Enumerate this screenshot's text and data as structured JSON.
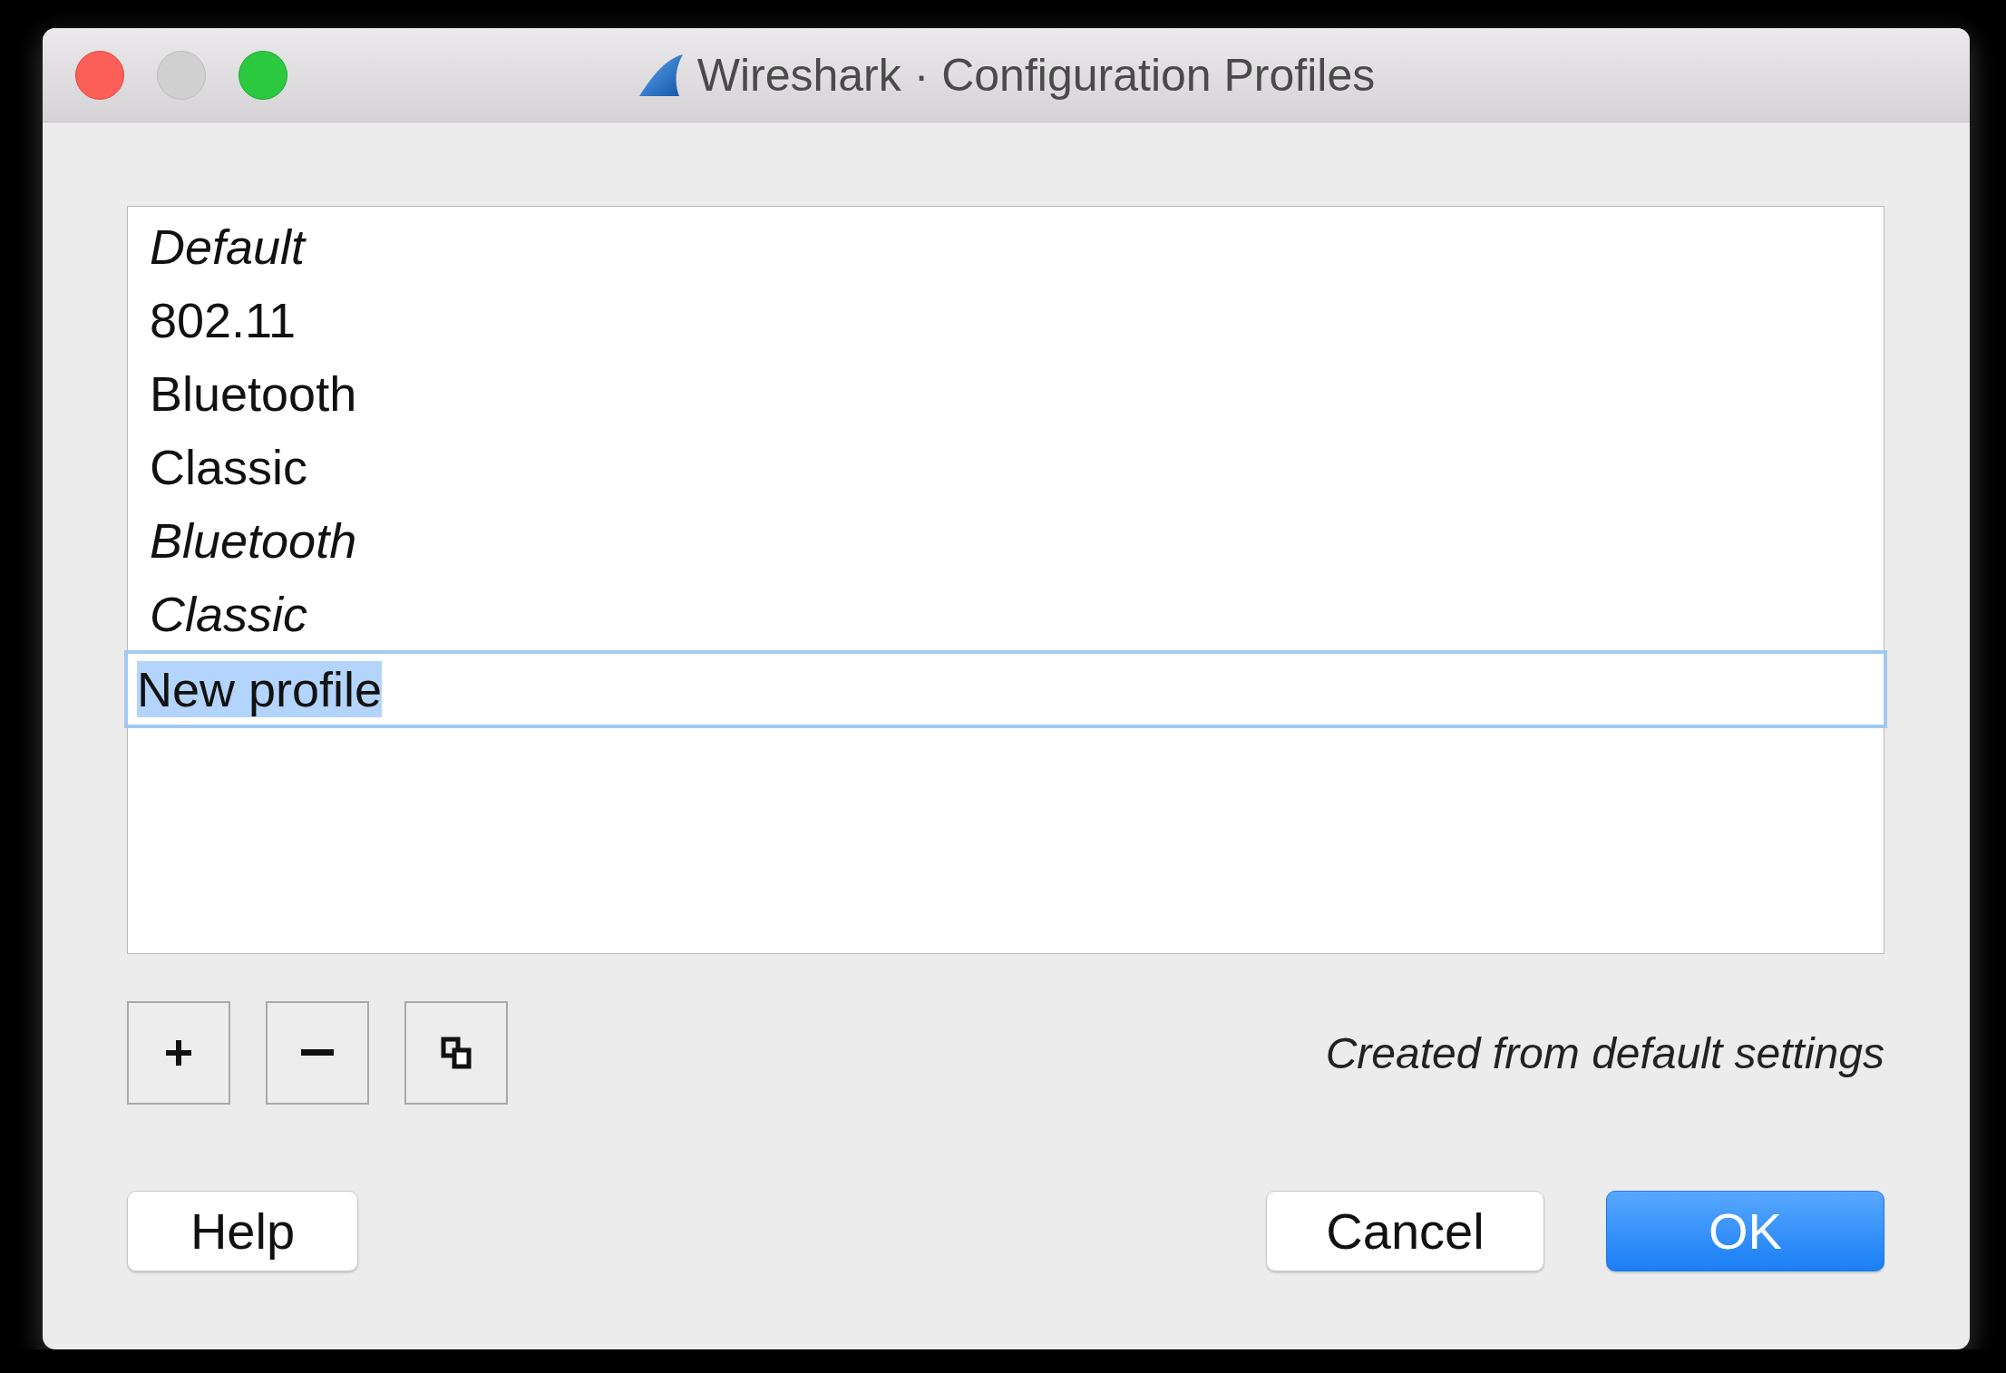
{
  "window": {
    "title": "Wireshark · Configuration Profiles"
  },
  "profiles": [
    {
      "name": "Default",
      "kind": "global"
    },
    {
      "name": "802.11",
      "kind": "personal"
    },
    {
      "name": "Bluetooth",
      "kind": "personal"
    },
    {
      "name": "Classic",
      "kind": "personal"
    },
    {
      "name": "Bluetooth",
      "kind": "global"
    },
    {
      "name": "Classic",
      "kind": "global"
    },
    {
      "name": "New profile",
      "kind": "editing"
    }
  ],
  "tool_buttons": [
    {
      "kind": "add"
    },
    {
      "kind": "remove"
    },
    {
      "kind": "copy"
    }
  ],
  "info": "Created from default settings",
  "buttons": [
    {
      "label": "Help",
      "kind": "plain"
    },
    {
      "label": "Cancel",
      "kind": "plain"
    },
    {
      "label": "OK",
      "kind": "default"
    }
  ]
}
